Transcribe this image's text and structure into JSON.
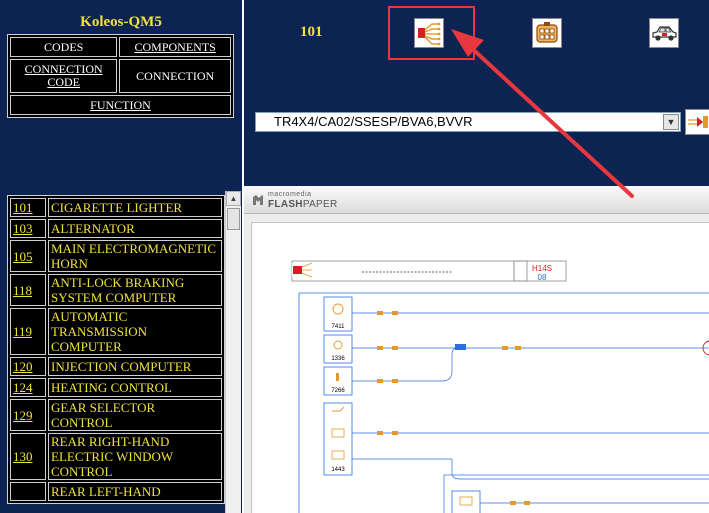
{
  "app": {
    "title": "Koleos-QM5"
  },
  "menu": {
    "codes": "CODES",
    "components": "COMPONENTS",
    "connection_code_line1": "CONNECTION",
    "connection_code_line2": "CODE",
    "connection": "CONNECTION",
    "function": "FUNCTION"
  },
  "header": {
    "page_code": "101",
    "icons": {
      "wiring": "wiring-harness-icon",
      "component": "connector-icon",
      "vehicle": "vehicle-icon"
    },
    "highlight_color": "#e8383d"
  },
  "config": {
    "selected": "TR4X4/CA02/SSESP/BVA6,BVVR"
  },
  "functions": [
    {
      "code": "101",
      "name": "CIGARETTE LIGHTER"
    },
    {
      "code": "103",
      "name": "ALTERNATOR"
    },
    {
      "code": "105",
      "name": "MAIN ELECTROMAGNETIC HORN"
    },
    {
      "code": "118",
      "name": "ANTI-LOCK BRAKING SYSTEM COMPUTER"
    },
    {
      "code": "119",
      "name": "AUTOMATIC TRANSMISSION COMPUTER"
    },
    {
      "code": "120",
      "name": "INJECTION COMPUTER"
    },
    {
      "code": "124",
      "name": "HEATING CONTROL"
    },
    {
      "code": "129",
      "name": "GEAR SELECTOR CONTROL"
    },
    {
      "code": "130",
      "name": "REAR RIGHT-HAND ELECTRIC WINDOW CONTROL"
    },
    {
      "code": "",
      "name": "REAR LEFT-HAND"
    }
  ],
  "viewer": {
    "brand_small": "macromedia",
    "brand_big_bold": "FLASH",
    "brand_big_rest": "PAPER",
    "doc": {
      "page_label": "H14S",
      "page_number": "08",
      "components": [
        "7411",
        "1336",
        "7266",
        "1443"
      ]
    }
  },
  "colors": {
    "navy": "#0d2452",
    "yellow": "#f0e23c",
    "schematic_line": "#2a6fdc"
  }
}
